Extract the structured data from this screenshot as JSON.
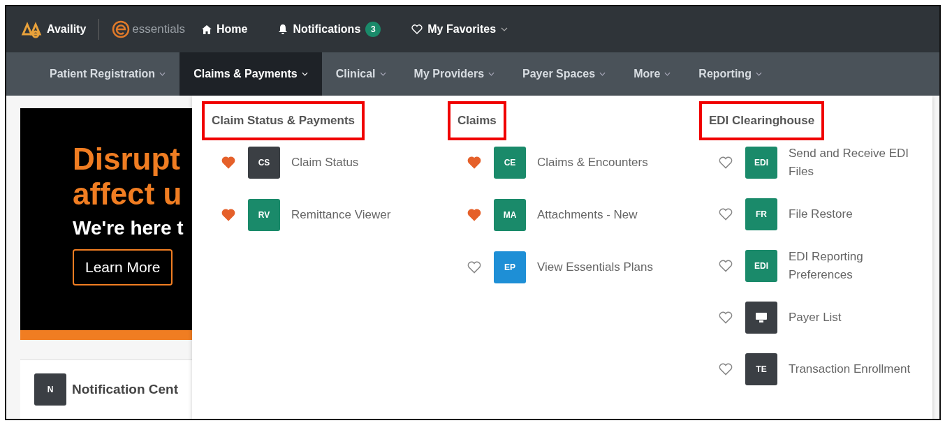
{
  "top_bar": {
    "brand": "Availity",
    "product": "essentials",
    "links": [
      {
        "kind": "home",
        "label": "Home"
      },
      {
        "kind": "notifications",
        "label": "Notifications",
        "badge": "3"
      },
      {
        "kind": "favorites",
        "label": "My Favorites"
      }
    ]
  },
  "nav": [
    {
      "label": "Patient Registration",
      "selected": false
    },
    {
      "label": "Claims & Payments",
      "selected": true
    },
    {
      "label": "Clinical",
      "selected": false
    },
    {
      "label": "My Providers",
      "selected": false
    },
    {
      "label": "Payer Spaces",
      "selected": false
    },
    {
      "label": "More",
      "selected": false
    },
    {
      "label": "Reporting",
      "selected": false
    }
  ],
  "banner": {
    "headline": [
      "Disrupt",
      "affect u"
    ],
    "subtitle": "We're here t",
    "button": "Learn More"
  },
  "notification_card": {
    "badge": "N",
    "title": "Notification Cent"
  },
  "dropdown": {
    "sections": [
      {
        "title": "Claim Status & Payments",
        "highlighted": true,
        "items": [
          {
            "label": "Claim Status",
            "tile": "CS",
            "kind": "text",
            "color": "#3b3f44",
            "favorite": true
          },
          {
            "label": "Remittance Viewer",
            "tile": "RV",
            "kind": "text",
            "color": "#1a8a6a",
            "favorite": true
          }
        ]
      },
      {
        "title": "Claims",
        "highlighted": true,
        "items": [
          {
            "label": "Claims & Encounters",
            "tile": "CE",
            "kind": "text",
            "color": "#1a8a6a",
            "favorite": true
          },
          {
            "label": "Attachments - New",
            "tile": "MA",
            "kind": "text",
            "color": "#1a8a6a",
            "favorite": true
          },
          {
            "label": "View Essentials Plans",
            "tile": "EP",
            "kind": "text",
            "color": "#1e8fd6",
            "favorite": false
          }
        ]
      },
      {
        "title": "EDI Clearinghouse",
        "highlighted": true,
        "items": [
          {
            "label": "Send and Receive EDI Files",
            "tile": "EDI",
            "kind": "text",
            "color": "#1a8a6a",
            "favorite": false
          },
          {
            "label": "File Restore",
            "tile": "FR",
            "kind": "text",
            "color": "#1a8a6a",
            "favorite": false
          },
          {
            "label": "EDI Reporting Preferences",
            "tile": "EDI",
            "kind": "text",
            "color": "#1a8a6a",
            "favorite": false
          },
          {
            "label": "Payer List",
            "kind": "monitor",
            "color": "#3b3f44",
            "favorite": false
          },
          {
            "label": "Transaction Enrollment",
            "tile": "TE",
            "kind": "text",
            "color": "#3b3f44",
            "favorite": false
          }
        ]
      }
    ]
  }
}
